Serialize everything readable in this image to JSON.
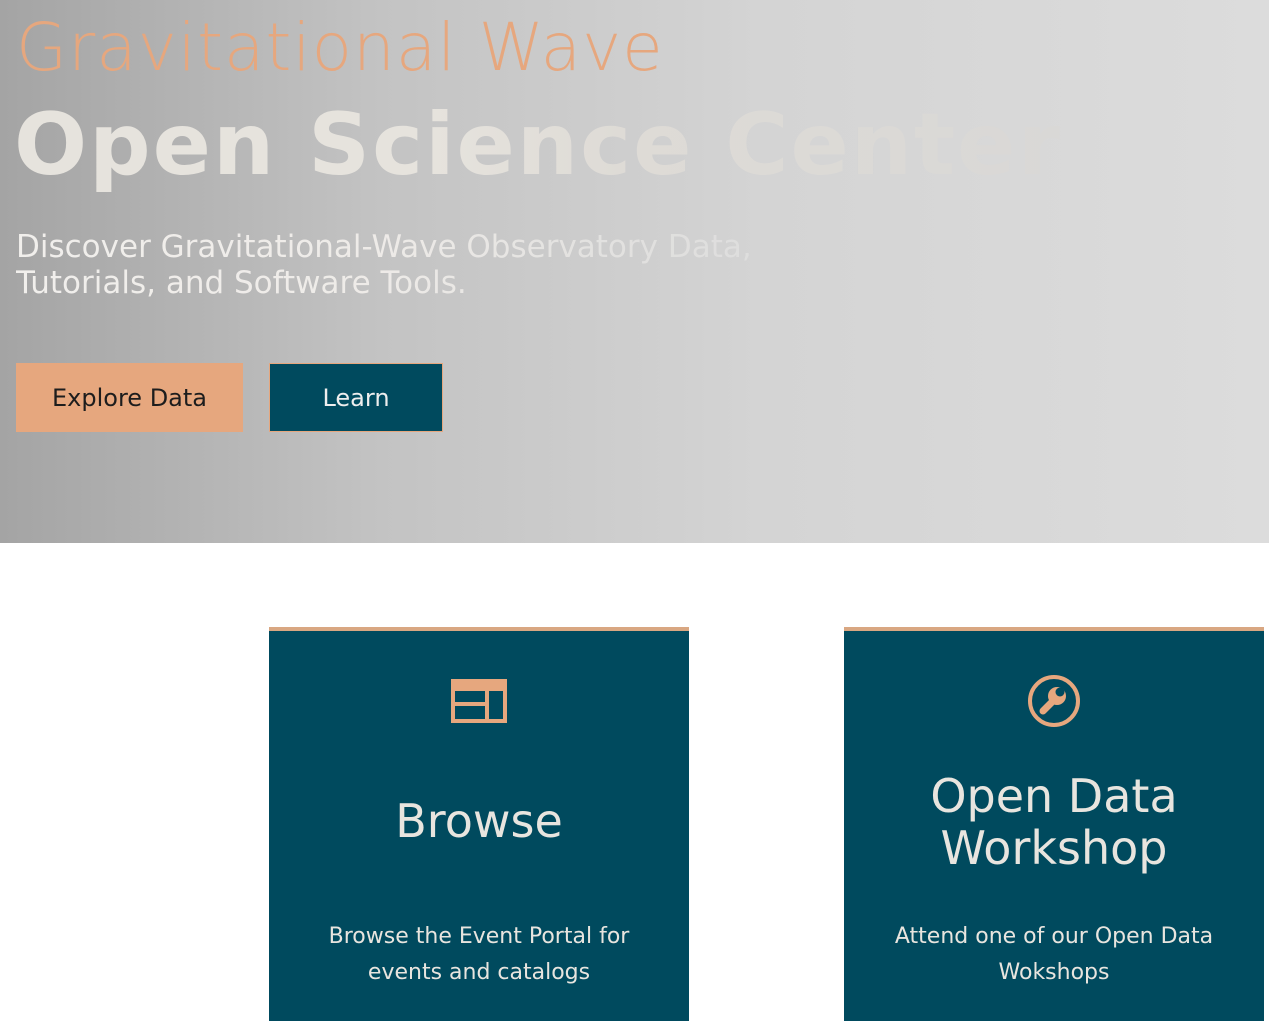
{
  "hero": {
    "title_light": "Gravitational Wave",
    "title_bold": "Open Science Center",
    "subtitle_line1": "Discover Gravitational-Wave Observatory Data,",
    "subtitle_line2": "Tutorials, and Software Tools.",
    "buttons": {
      "explore_label": "Explore Data",
      "learn_label": "Learn"
    }
  },
  "cards": [
    {
      "icon": "browser-window-icon",
      "title": "Browse",
      "description": "Browse the Event Portal for events and catalogs"
    },
    {
      "icon": "wrench-icon",
      "title_line1": "Open Data",
      "title_line2": "Workshop",
      "description": "Attend one of our Open Data Wokshops"
    }
  ],
  "colors": {
    "accent": "#e6a77e",
    "card_background": "#004a5e",
    "card_text": "#e8e5df"
  }
}
